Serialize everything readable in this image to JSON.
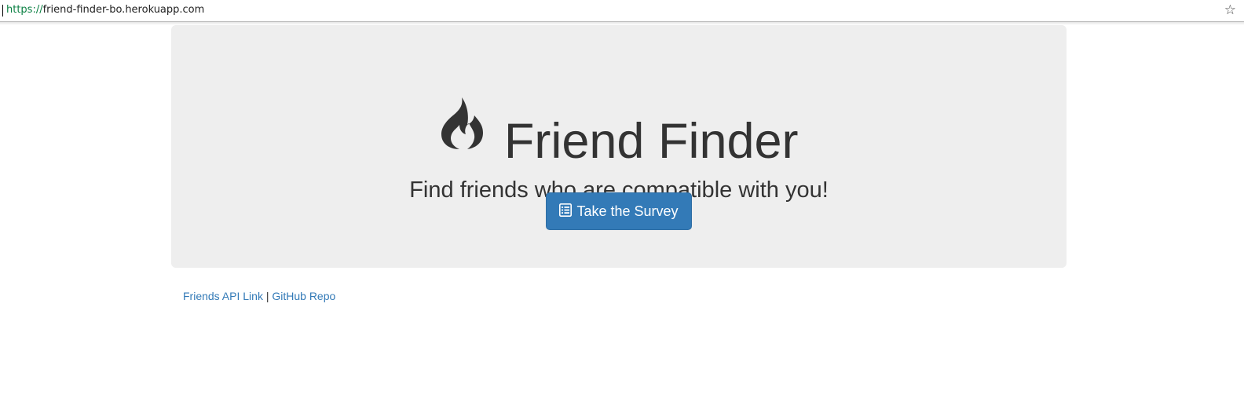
{
  "browser": {
    "url_scheme": "https://",
    "url_host": "friend-finder-bo.herokuapp.com",
    "bookmark_icon": "star-outline-icon"
  },
  "jumbotron": {
    "icon": "fire-icon",
    "title": "Friend Finder",
    "subtitle": "Find friends who are compatible with you!",
    "button": {
      "icon": "list-alt-icon",
      "label": "Take the Survey",
      "color": "#337ab7"
    },
    "background": "#eeeeee"
  },
  "footer": {
    "api_link": "Friends API Link",
    "separator": "|",
    "repo_link": "GitHub Repo",
    "link_color": "#337ab7"
  }
}
